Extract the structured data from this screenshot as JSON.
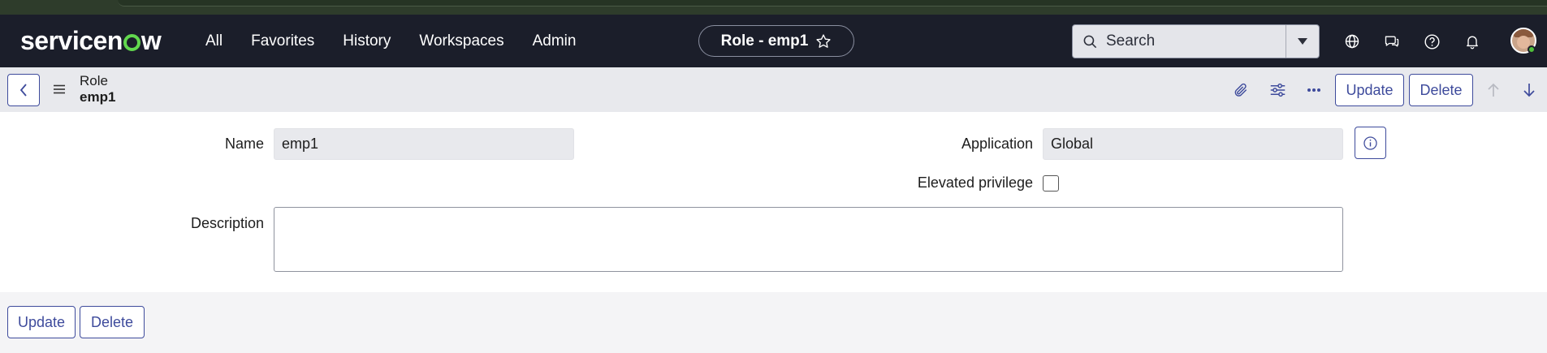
{
  "topnav": {
    "logo_text_before": "servicen",
    "logo_text_after": "w",
    "menu": [
      "All",
      "Favorites",
      "History",
      "Workspaces",
      "Admin"
    ],
    "context_title": "Role - emp1",
    "search_placeholder": "Search"
  },
  "header": {
    "record_type": "Role",
    "record_name": "emp1",
    "update_label": "Update",
    "delete_label": "Delete"
  },
  "form": {
    "name_label": "Name",
    "name_value": "emp1",
    "application_label": "Application",
    "application_value": "Global",
    "elevated_label": "Elevated privilege",
    "elevated_checked": false,
    "description_label": "Description",
    "description_value": ""
  },
  "footer": {
    "update_label": "Update",
    "delete_label": "Delete"
  },
  "colors": {
    "nav_bg": "#1b1e2a",
    "accent": "#3e4b9c",
    "logo_green": "#62d84e",
    "header_bg": "#e8e9ed"
  }
}
